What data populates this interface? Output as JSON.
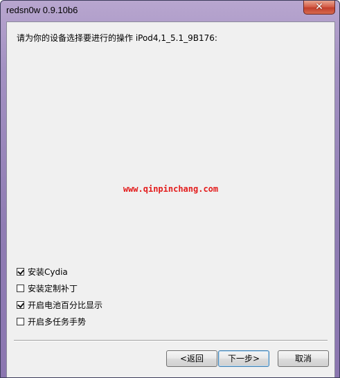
{
  "window": {
    "title": "redsn0w 0.9.10b6",
    "close_glyph": "✕"
  },
  "main": {
    "prompt": "请为你的设备选择要进行的操作 iPod4,1_5.1_9B176:",
    "watermark": "www.qinpinchang.com"
  },
  "options": [
    {
      "label": "安装Cydia",
      "checked": true
    },
    {
      "label": "安装定制补丁",
      "checked": false
    },
    {
      "label": "开启电池百分比显示",
      "checked": true
    },
    {
      "label": "开启多任务手势",
      "checked": false
    }
  ],
  "buttons": {
    "back": "<返回",
    "next": "下一步>",
    "cancel": "取消"
  },
  "colors": {
    "watermark": "#e31b1b",
    "frame": "#a391c2",
    "client_bg": "#f0f0f0"
  }
}
